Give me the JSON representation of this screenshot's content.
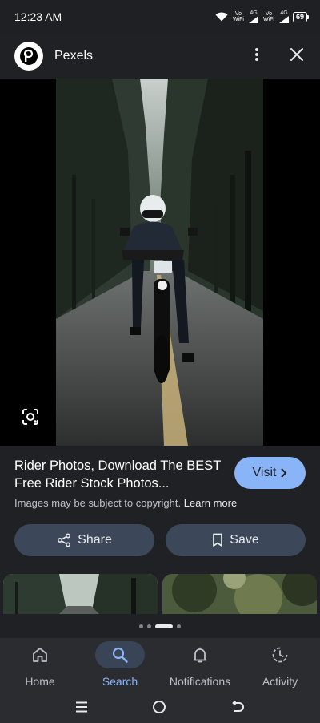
{
  "status_bar": {
    "time": "12:23 AM",
    "net1_top": "Vo",
    "net1_bottom": "WiFi",
    "signal1": "4G",
    "net2_top": "Vo",
    "net2_bottom": "WiFi",
    "signal2": "4G",
    "battery": "69"
  },
  "header": {
    "source_name": "Pexels"
  },
  "result": {
    "title": "Rider Photos, Download The BEST Free Rider Stock Photos...",
    "visit_label": "Visit",
    "copyright_text": "Images may be subject to copyright.",
    "learn_more": "Learn more",
    "share_label": "Share",
    "save_label": "Save"
  },
  "bottom_nav": {
    "items": [
      {
        "label": "Home",
        "icon": "home-icon"
      },
      {
        "label": "Search",
        "icon": "search-icon"
      },
      {
        "label": "Notifications",
        "icon": "bell-icon"
      },
      {
        "label": "Activity",
        "icon": "activity-icon"
      }
    ],
    "active": "Search"
  },
  "colors": {
    "background": "#202124",
    "accent": "#8ab4f8",
    "pill": "#3c4859"
  }
}
